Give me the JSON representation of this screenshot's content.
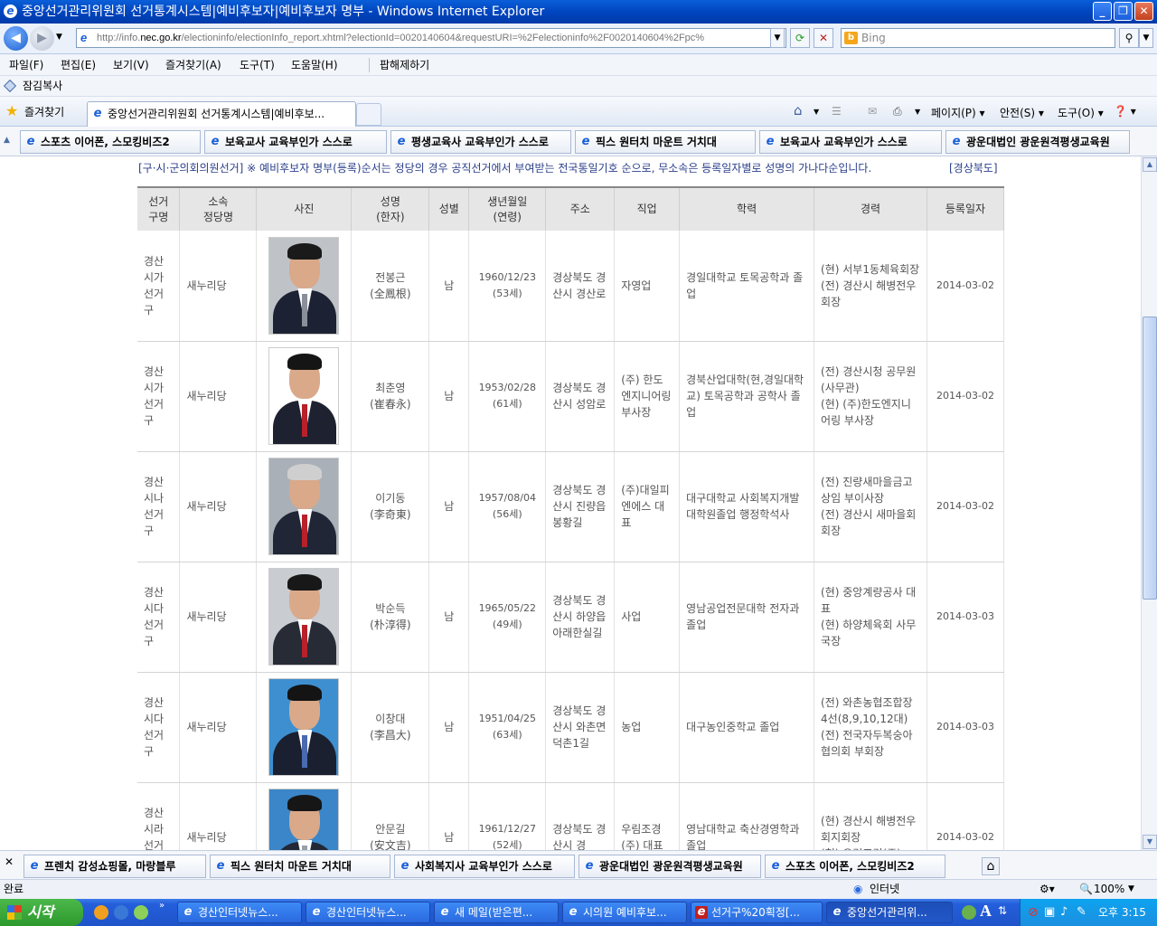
{
  "window": {
    "title": "중앙선거관리위원회 선거통계시스템|예비후보자|예비후보자 명부 - Windows Internet Explorer",
    "min": "_",
    "max": "❐",
    "close": "✕"
  },
  "address": {
    "url_prefix": "http://info.",
    "url_domain": "nec.go.kr",
    "url_rest": "/electioninfo/electionInfo_report.xhtml?electionId=0020140604&requestURI=%2Felectioninfo%2F0020140604%2Fpc%",
    "search_placeholder": "Bing"
  },
  "menu": {
    "items": [
      "파일(F)",
      "편집(E)",
      "보기(V)",
      "즐겨찾기(A)",
      "도구(T)",
      "도움말(H)"
    ],
    "extra": "팝해제하기"
  },
  "favbar": {
    "item": "잠김복사"
  },
  "cmdbar": {
    "favorites": "즐겨찾기",
    "tab_title": "중앙선거관리위원회 선거통계시스템|예비후보...",
    "page": "페이지(P) ▾",
    "safety": "안전(S) ▾",
    "tools": "도구(O) ▾",
    "help": "❓ ▾"
  },
  "linkbar": {
    "items": [
      "스포츠 이어폰, 스모킹비즈2",
      "보육교사 교육부인가 스스로",
      "평생교육사 교육부인가 스스로",
      "픽스 원터치 마운트 거치대",
      "보육교사 교육부인가 스스로",
      "광운대법인 광운원격평생교육원"
    ]
  },
  "page": {
    "notice_prefix": "[구·시·군의회의원선거]",
    "notice_text": "※ 예비후보자 명부(등록)순서는 정당의 경우 공직선거에서 부여받는 전국통일기호 순으로, 무소속은 등록일자별로 성명의 가나다순입니다.",
    "region": "[경상북도]"
  },
  "table": {
    "headers": [
      "선거\n구명",
      "소속\n정당명",
      "사진",
      "성명\n(한자)",
      "성별",
      "생년월일\n(연령)",
      "주소",
      "직업",
      "학력",
      "경력",
      "등록일자"
    ],
    "rows": [
      {
        "district": "경산시가선거구",
        "party": "새누리당",
        "name": "전봉근",
        "hanja": "(全鳳根)",
        "gender": "남",
        "birth": "1960/12/23",
        "age": "(53세)",
        "address": "경상북도 경산시 경산로",
        "job": "자영업",
        "edu": "경일대학교 토목공학과 졸업",
        "career": "(현) 서부1동체육회장\n(전) 경산시 해병전우회장",
        "date": "2014-03-02"
      },
      {
        "district": "경산시가선거구",
        "party": "새누리당",
        "name": "최춘영",
        "hanja": "(崔春永)",
        "gender": "남",
        "birth": "1953/02/28",
        "age": "(61세)",
        "address": "경상북도 경산시 성암로",
        "job": "(주) 한도엔지니어링 부사장",
        "edu": "경북산업대학(현,경일대학교) 토목공학과 공학사 졸업",
        "career": "(전) 경산시청 공무원(사무관)\n(현) (주)한도엔지니어링 부사장",
        "date": "2014-03-02"
      },
      {
        "district": "경산시나선거구",
        "party": "새누리당",
        "name": "이기동",
        "hanja": "(李奇東)",
        "gender": "남",
        "birth": "1957/08/04",
        "age": "(56세)",
        "address": "경상북도 경산시 진량읍 봉황길",
        "job": "(주)대일피엔에스 대표",
        "edu": "대구대학교 사회복지개발대학원졸업 행정학석사",
        "career": "(전) 진량새마을금고 상임 부이사장\n(전) 경산시 새마을회 회장",
        "date": "2014-03-02"
      },
      {
        "district": "경산시다선거구",
        "party": "새누리당",
        "name": "박순득",
        "hanja": "(朴淳得)",
        "gender": "남",
        "birth": "1965/05/22",
        "age": "(49세)",
        "address": "경상북도 경산시 하양읍 아래한실길",
        "job": "사업",
        "edu": "영남공업전문대학 전자과 졸업",
        "career": "(현) 중앙계량공사 대표\n(현) 하양체육회 사무국장",
        "date": "2014-03-03"
      },
      {
        "district": "경산시다선거구",
        "party": "새누리당",
        "name": "이창대",
        "hanja": "(李昌大)",
        "gender": "남",
        "birth": "1951/04/25",
        "age": "(63세)",
        "address": "경상북도 경산시 와촌면 덕촌1길",
        "job": "농업",
        "edu": "대구농인중학교 졸업",
        "career": "(전) 와촌농협조합장 4선(8,9,10,12대)\n(전) 전국자두복숭아협의회 부회장",
        "date": "2014-03-03"
      },
      {
        "district": "경산시라선거구",
        "party": "새누리당",
        "name": "안문길",
        "hanja": "(安文吉)",
        "gender": "남",
        "birth": "1961/12/27",
        "age": "(52세)",
        "address": "경상북도 경산시 경",
        "job": "우림조경(주) 대표",
        "edu": "영남대학교 축산경영학과 졸업",
        "career": "(현) 경산시 해병전우회지회장\n(현) 우림조경(주)",
        "date": "2014-03-02"
      }
    ]
  },
  "bottombar": {
    "close": "✕",
    "items": [
      "프렌치 감성쇼핑몰, 마랑블루",
      "픽스 원터치 마운트 거치대",
      "사회복지사 교육부인가 스스로",
      "광운대법인 광운원격평생교육원",
      "스포츠 이어폰, 스모킹비즈2"
    ]
  },
  "status": {
    "left": "완료",
    "zone": "인터넷",
    "zoom": "100%"
  },
  "taskbar": {
    "start": "시작",
    "items": [
      "경산인터넷뉴스...",
      "경산인터넷뉴스...",
      "새 메일(받은편...",
      "시의원 예비후보...",
      "선거구%20획정[...",
      "중앙선거관리위..."
    ],
    "clock": "오후 3:15"
  }
}
